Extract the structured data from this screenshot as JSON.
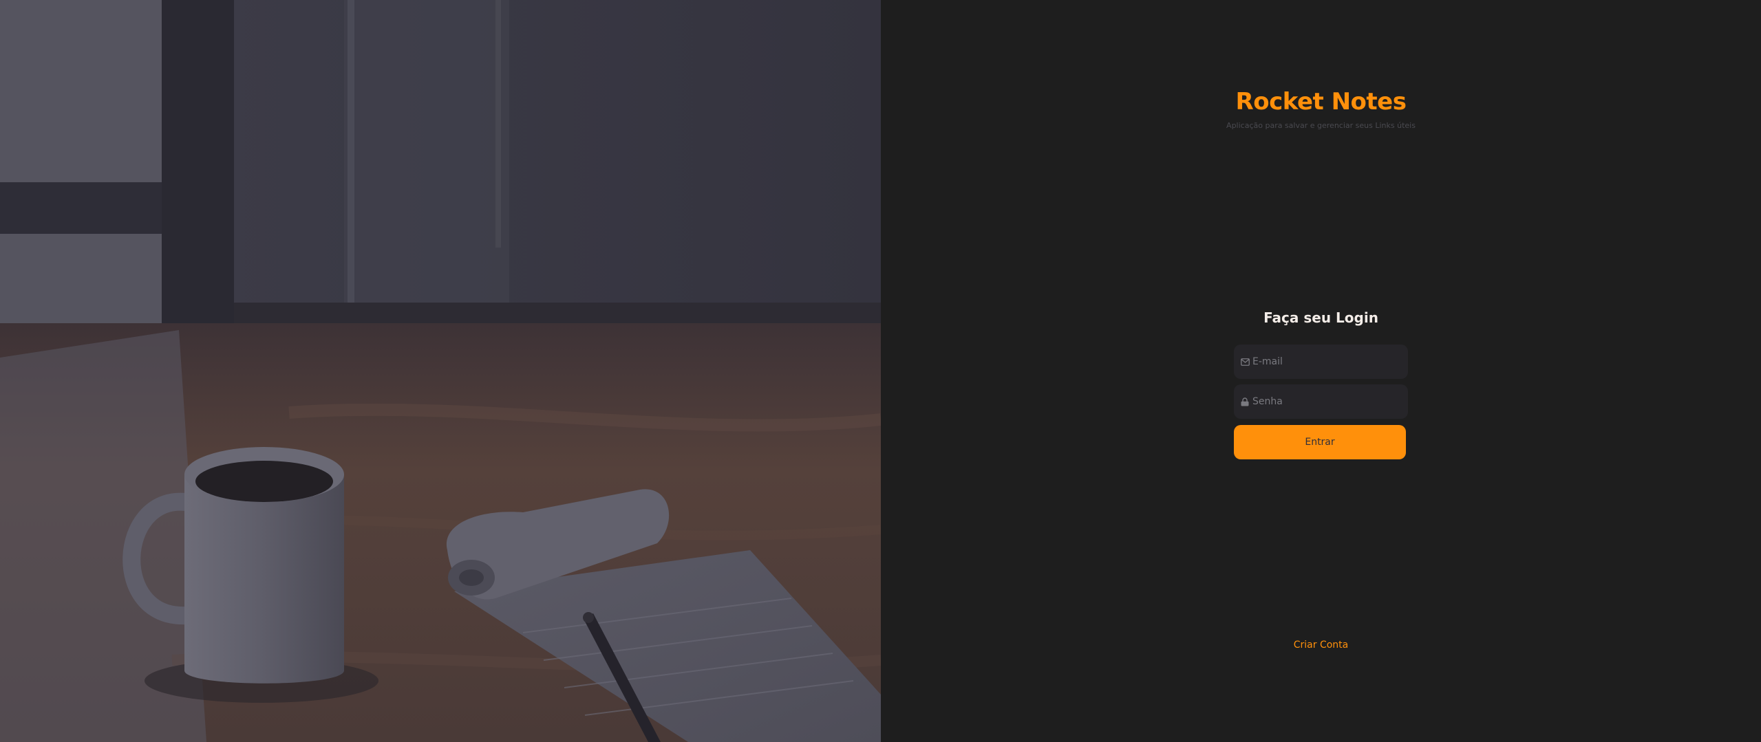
{
  "brand": {
    "title": "Rocket Notes",
    "subtitle": "Aplicação para salvar e gerenciar seus Links úteis"
  },
  "form": {
    "title": "Faça seu Login",
    "email": {
      "placeholder": "E-mail",
      "value": "",
      "icon": "mail-icon"
    },
    "password": {
      "placeholder": "Senha",
      "value": "",
      "icon": "lock-icon"
    },
    "submit_label": "Entrar"
  },
  "footer": {
    "create_account_label": "Criar Conta"
  },
  "colors": {
    "accent": "#ff900b",
    "panel_background": "#1e1e1e",
    "input_background": "#262529",
    "title_text": "#f4ede8",
    "muted_text": "#4a4a50"
  }
}
